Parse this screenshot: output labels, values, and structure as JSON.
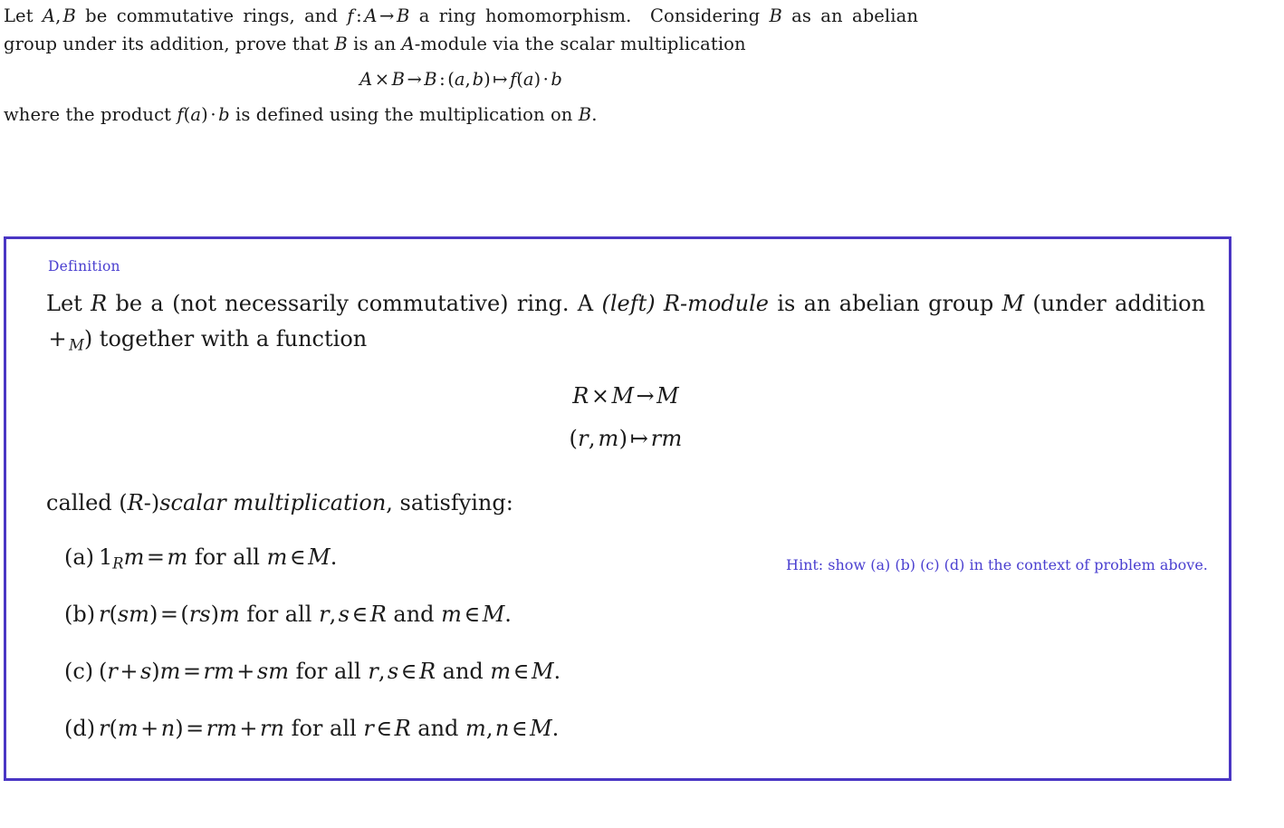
{
  "problem": {
    "line1": "Let A, B be commutative rings, and f : A → B a ring homomorphism.  Considering",
    "line2": "B as an abelian group under its addition, prove that B is an A-module via the scalar",
    "line3": "multiplication",
    "display_equation": "A × B → B : (a, b) ↦ f(a) · b",
    "line4": "where the product f(a) · b is defined using the multiplication on B."
  },
  "definition": {
    "label": "Definition",
    "line1": "Let R be a (not necessarily commutative) ring. A (left) R-module is an abelian group M (under",
    "line2": "addition +M) together with a function",
    "display_equation_1": "R × M → M",
    "display_equation_2": "(r, m) ↦ rm",
    "called_line": "called (R-)scalar multiplication, satisfying:",
    "axioms": [
      {
        "tag": "(a)",
        "text": "1R m = m for all m ∈ M."
      },
      {
        "tag": "(b)",
        "text": "r(sm) = (rs)m for all r, s ∈ R and m ∈ M."
      },
      {
        "tag": "(c)",
        "text": "(r + s)m = rm + sm for all r, s ∈ R and m ∈ M."
      },
      {
        "tag": "(d)",
        "text": "r(m + n) = rm + rn for all r ∈ R and m, n ∈ M."
      }
    ]
  },
  "hint": {
    "text": "Hint: show (a) (b) (c) (d) in the context of problem above."
  },
  "colors": {
    "box_border": "#4a36c4",
    "definition_label": "#4a3fd0",
    "hint_text": "#4a3fd0",
    "body_text": "#1a1a1a",
    "background": "#ffffff"
  }
}
